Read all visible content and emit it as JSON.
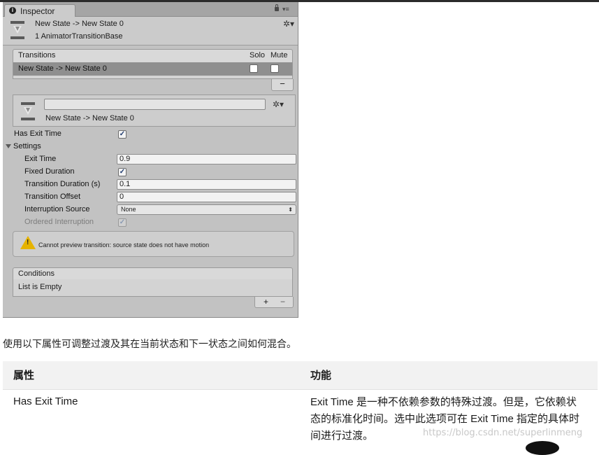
{
  "inspector": {
    "tab_label": "Inspector",
    "header": {
      "title": "New State -> New State 0",
      "subtitle": "1 AnimatorTransitionBase"
    },
    "transitions": {
      "header": "Transitions",
      "solo_label": "Solo",
      "mute_label": "Mute",
      "rows": [
        {
          "label": "New State -> New State 0",
          "solo": false,
          "mute": false
        }
      ],
      "remove_label": "−"
    },
    "sub_header": {
      "name_value": "",
      "title": "New State -> New State 0"
    },
    "properties": {
      "has_exit_time_label": "Has Exit Time",
      "has_exit_time": true,
      "settings_label": "Settings",
      "exit_time_label": "Exit Time",
      "exit_time_value": "0.9",
      "fixed_duration_label": "Fixed Duration",
      "fixed_duration": true,
      "transition_duration_label": "Transition Duration (s)",
      "transition_duration_value": "0.1",
      "transition_offset_label": "Transition Offset",
      "transition_offset_value": "0",
      "interruption_source_label": "Interruption Source",
      "interruption_source_value": "None",
      "ordered_interruption_label": "Ordered Interruption",
      "ordered_interruption": true
    },
    "warning": "Cannot preview transition: source state does not have motion",
    "conditions": {
      "header": "Conditions",
      "empty_text": "List is Empty",
      "add_label": "+",
      "remove_label": "−"
    }
  },
  "description": "使用以下属性可调整过渡及其在当前状态和下一状态之间如何混合。",
  "table": {
    "headers": [
      "属性",
      "功能"
    ],
    "rows": [
      {
        "property": "Has Exit Time",
        "function": "Exit Time 是一种不依赖参数的特殊过渡。但是，它依赖状态的标准化时间。选中此选项可在 Exit Time 指定的具体时间进行过渡。"
      }
    ]
  },
  "watermark": "https://blog.csdn.net/superlinmeng",
  "icons": {
    "info": "info-icon",
    "lock": "lock-icon",
    "menu": "menu-icon",
    "transition": "transition-icon",
    "gear": "gear-icon",
    "warning": "warning-icon",
    "foldout": "foldout-arrow-icon",
    "checkbox": "checkmark-icon"
  },
  "colors": {
    "panel_bg": "#c2c2c2",
    "selected_row": "#8f8f8f",
    "warning": "#e6b300",
    "table_header_bg": "#f2f2f2"
  }
}
